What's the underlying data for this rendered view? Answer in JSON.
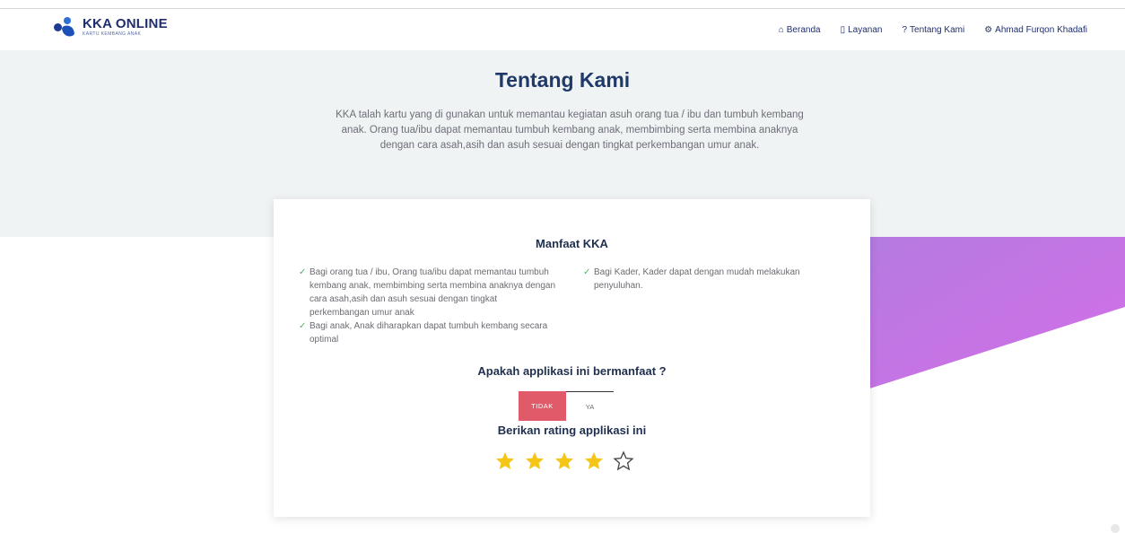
{
  "brand": {
    "title": "KKA ONLINE",
    "subtitle": "KARTU KEMBANG ANAK"
  },
  "nav": {
    "items": [
      {
        "label": "Beranda",
        "icon": "home-icon"
      },
      {
        "label": "Layanan",
        "icon": "bookmark-icon"
      },
      {
        "label": "Tentang Kami",
        "icon": "question-icon"
      },
      {
        "label": "Ahmad Furqon Khadafi",
        "icon": "gear-icon"
      }
    ]
  },
  "hero": {
    "title": "Tentang Kami",
    "description": "KKA talah kartu yang di gunakan untuk memantau kegiatan asuh orang tua / ibu dan tumbuh kembang anak. Orang tua/ibu dapat memantau tumbuh kembang anak, membimbing serta membina anaknya dengan cara asah,asih dan asuh sesuai dengan tingkat perkembangan umur anak."
  },
  "card": {
    "title": "Manfaat KKA",
    "benefits_left": [
      "Bagi orang tua / ibu, Orang tua/ibu dapat memantau tumbuh kembang anak, membimbing serta membina anaknya dengan cara asah,asih dan asuh sesuai dengan tingkat perkembangan umur anak",
      "Bagi anak, Anak diharapkan dapat tumbuh kembang secara optimal"
    ],
    "benefits_right": [
      "Bagi Kader, Kader dapat dengan mudah melakukan penyuluhan."
    ],
    "question": "Apakah applikasi ini bermanfaat ?",
    "btn_no": "TIDAK",
    "btn_yes": "YA",
    "rating_label": "Berikan rating applikasi ini",
    "rating": {
      "value": 4,
      "max": 5
    }
  },
  "colors": {
    "accent_no": "#e05a6a",
    "star_filled": "#f5c518",
    "purple_from": "#b47be0",
    "purple_to": "#d46ee8"
  }
}
